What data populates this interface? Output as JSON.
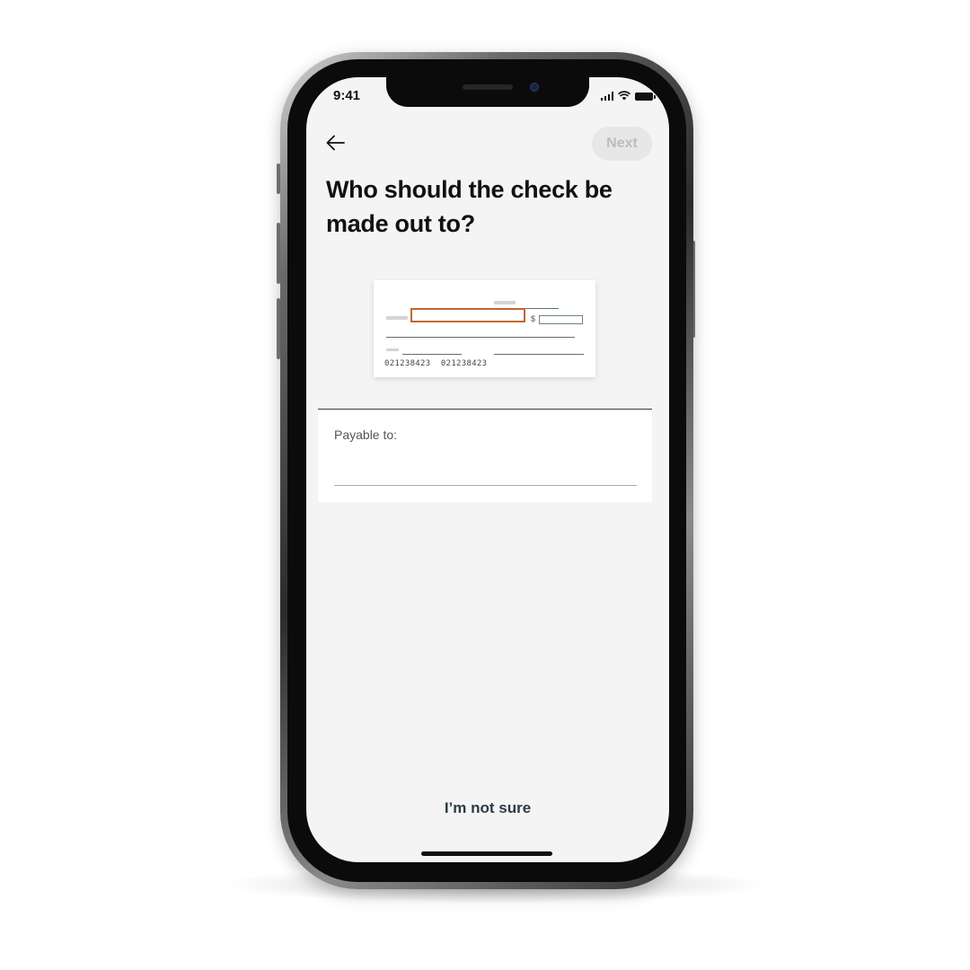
{
  "status_bar": {
    "time": "9:41",
    "icons": [
      "signal-icon",
      "wifi-icon",
      "battery-icon"
    ]
  },
  "header": {
    "back_icon": "arrow-left-icon",
    "next_label": "Next"
  },
  "title": "Who should the check be made out to?",
  "check_illustration": {
    "dollar_sign": "$",
    "routing_numbers": "021238423  021238423",
    "highlight_color": "#c2672f"
  },
  "form": {
    "label": "Payable to:",
    "value": "",
    "placeholder": ""
  },
  "footer": {
    "not_sure_label": "I’m not sure"
  }
}
